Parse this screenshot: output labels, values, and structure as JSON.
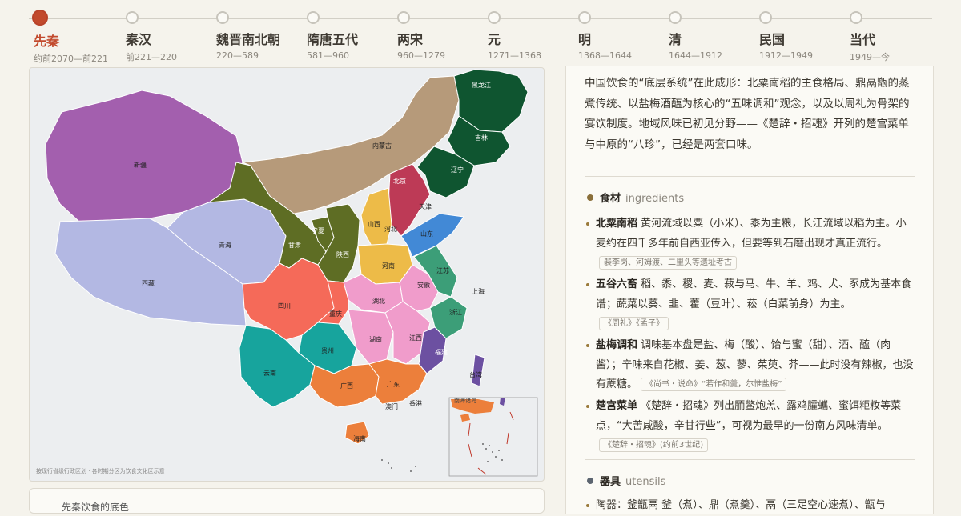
{
  "timeline": [
    {
      "name": "先秦",
      "range": "约前2070—前221",
      "active": true
    },
    {
      "name": "秦汉",
      "range": "前221—220"
    },
    {
      "name": "魏晋南北朝",
      "range": "220—589"
    },
    {
      "name": "隋唐五代",
      "range": "581—960"
    },
    {
      "name": "两宋",
      "range": "960—1279"
    },
    {
      "name": "元",
      "range": "1271—1368"
    },
    {
      "name": "明",
      "range": "1368—1644"
    },
    {
      "name": "清",
      "range": "1644—1912"
    },
    {
      "name": "民国",
      "range": "1912—1949"
    },
    {
      "name": "当代",
      "range": "1949—今"
    }
  ],
  "map": {
    "provinces": {
      "xinjiang": "新疆",
      "xizang": "西藏",
      "qinghai": "青海",
      "gansu": "甘肃",
      "ningxia": "宁夏",
      "neimenggu": "内蒙古",
      "heilongjiang": "黑龙江",
      "jilin": "吉林",
      "liaoning": "辽宁",
      "beijing": "北京",
      "tianjin": "天津",
      "hebei": "河北",
      "shanxi": "山西",
      "shandong": "山东",
      "henan": "河南",
      "shaanxi": "陕西",
      "jiangsu": "江苏",
      "shanghai": "上海",
      "anhui": "安徽",
      "hubei": "湖北",
      "sichuan": "四川",
      "chongqing": "重庆",
      "zhejiang": "浙江",
      "hunan": "湖南",
      "jiangxi": "江西",
      "guizhou": "贵州",
      "yunnan": "云南",
      "fujian": "福建",
      "taiwan": "台湾",
      "guangxi": "广西",
      "guangdong": "广东",
      "aomen": "澳门",
      "xianggang": "香港",
      "hainan": "海南"
    },
    "nanhai_label": "南海诸岛",
    "note": "按现行省级行政区划 · 各时期分区为饮食文化区示意",
    "colors": {
      "purple": "#a35fae",
      "lavender": "#b3b8e3",
      "olive": "#5e6d24",
      "tan": "#b69a7a",
      "darkgreen": "#0f5530",
      "crimson": "#bd3a56",
      "gold": "#edbb48",
      "blue": "#4289d6",
      "teal": "#3c9e78",
      "pink": "#f09ccb",
      "coral": "#f56a59",
      "cyan": "#17a49d",
      "orange": "#ec7f3b",
      "violet": "#6c50a1"
    }
  },
  "bottom_card": {
    "title": "先秦饮食的底色"
  },
  "intro": "中国饮食的“底层系统”在此成形：北粟南稻的主食格局、鼎鬲甑的蒸煮传统、以盐梅酒醢为核心的“五味调和”观念，以及以周礼为骨架的宴饮制度。地域风味已初见分野——《楚辞・招魂》开列的楚宫菜单与中原的“八珍”，已经是两套口味。",
  "ingredients": {
    "title": "食材",
    "title_en": "ingredients",
    "bullet_color": "#8a6f3a",
    "items": [
      {
        "name": "北粟南稻",
        "text": "黄河流域以粟（小米）、黍为主粮，长江流域以稻为主。小麦约在四千多年前自西亚传入，但要等到石磨出现才真正流行。",
        "source": "裴李岗、河姆渡、二里头等遗址考古"
      },
      {
        "name": "五谷六畜",
        "text": "稻、黍、稷、麦、菽与马、牛、羊、鸡、犬、豕成为基本食谱；蔬菜以葵、韭、藿（豆叶）、菘（白菜前身）为主。",
        "source": "《周礼》《孟子》"
      },
      {
        "name": "盐梅调和",
        "text": "调味基本盘是盐、梅（酸）、饴与蜜（甜）、酒、醢（肉酱）；辛味来自花椒、姜、葱、蓼、茱萸、芥——此时没有辣椒，也没有蔗糖。",
        "source": "《尚书・说命》“若作和羹，尔惟盐梅”"
      },
      {
        "name": "楚宫菜单",
        "text": "《楚辞・招魂》列出胹鳖炮羔、露鸡臛蠵、蜜饵粔籹等菜点，“大苦咸酸，辛甘行些”，可视为最早的一份南方风味清单。",
        "source": "《楚辞・招魂》(约前3世纪)"
      }
    ]
  },
  "utensils": {
    "title": "器具",
    "title_en": "utensils",
    "bullet_color": "#5c6570",
    "first_line": "陶器：釜甑鬲 釜（煮）、鼎（煮羹）、鬲（三足空心速煮）、甑与"
  }
}
